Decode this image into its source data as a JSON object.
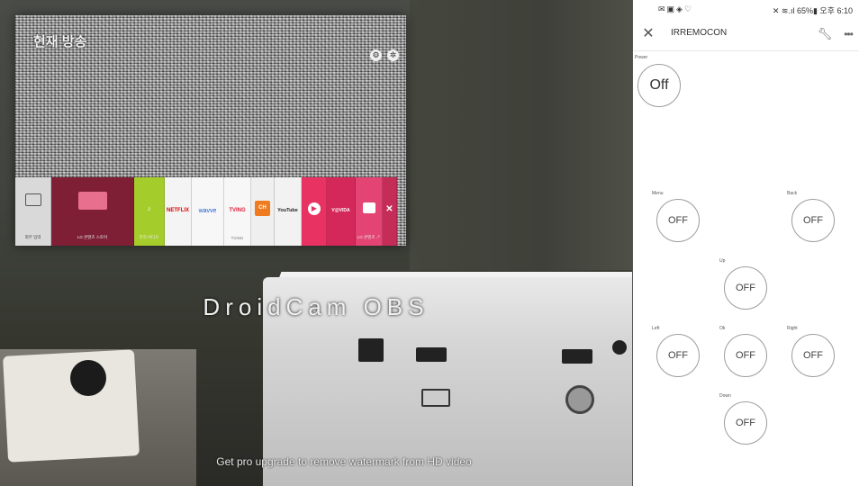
{
  "camera": {
    "channel_text": "현재 방송",
    "tiles": {
      "input_label": "외부 입력",
      "lgcontent_label": "LG 콘텐츠 스토어",
      "green_label": "뮤직 비디오",
      "netflix": "NETFLIX",
      "wavve": "wavve",
      "tving": "TVING",
      "tving_sub": "TVING",
      "ch_label": "CH",
      "youtube": "YouTube",
      "red2": "V@VIDA",
      "lgstore_label": "LG 콘텐츠 ↗"
    },
    "watermark": "DroidCam   OBS",
    "promo": "Get pro upgrade to remove watermark from HD video"
  },
  "phone": {
    "status": {
      "left_icons": "✉▣◈♡",
      "right_text": "✕ ≋.ıl 65%▮ 오후 6:10"
    },
    "app_title": "IRREMOCON",
    "icons": {
      "close": "close-icon",
      "wrench": "wrench-icon",
      "more": "more-icon"
    },
    "buttons": {
      "power": {
        "label": "Power",
        "value": "Off"
      },
      "menu": {
        "label": "Menu",
        "value": "OFF"
      },
      "back": {
        "label": "Back",
        "value": "OFF"
      },
      "up": {
        "label": "Up",
        "value": "OFF"
      },
      "left": {
        "label": "Left",
        "value": "OFF"
      },
      "ok": {
        "label": "Ok",
        "value": "OFF"
      },
      "right": {
        "label": "Right",
        "value": "OFF"
      },
      "down": {
        "label": "Down",
        "value": "OFF"
      }
    }
  }
}
